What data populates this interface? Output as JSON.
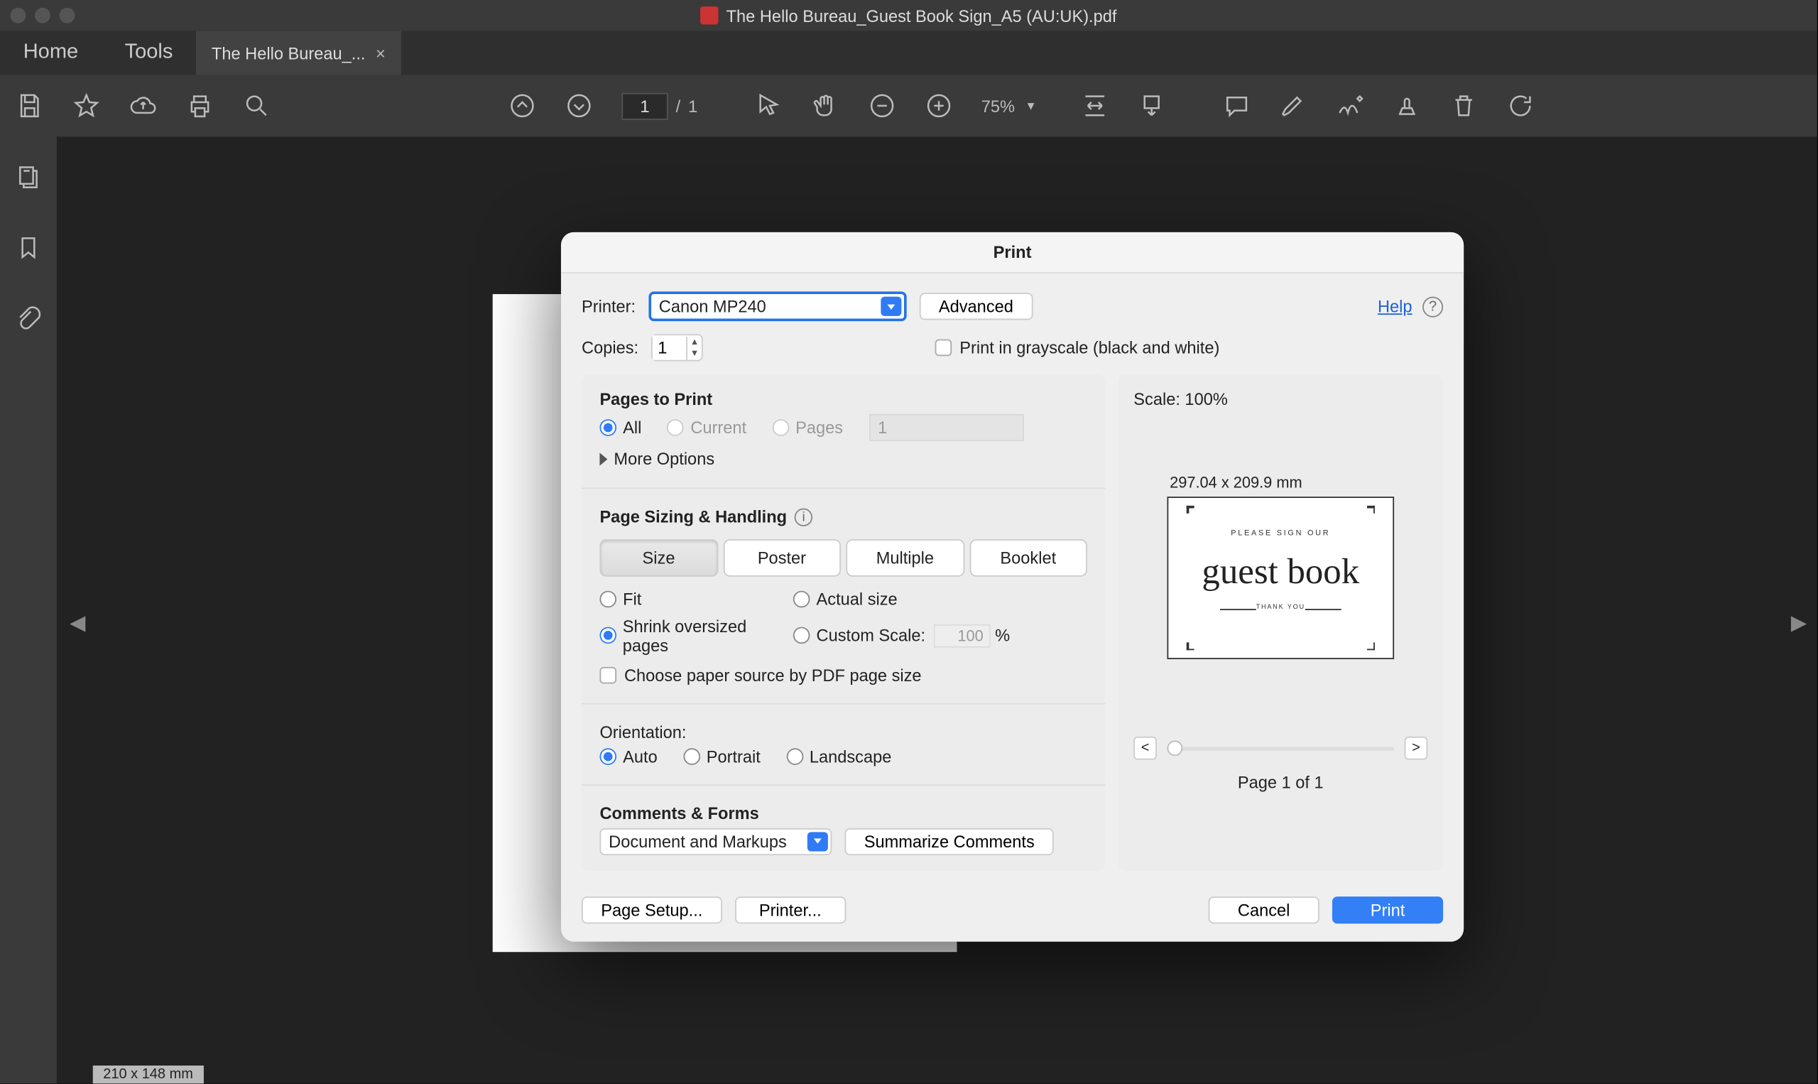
{
  "window": {
    "title": "The Hello Bureau_Guest Book Sign_A5 (AU:UK).pdf"
  },
  "tabs": {
    "home": "Home",
    "tools": "Tools",
    "document": "The Hello Bureau_..."
  },
  "toolbar": {
    "page_current": "1",
    "page_sep": "/",
    "page_total": "1",
    "zoom": "75%"
  },
  "doc": {
    "dim_label": "210 x 148 mm"
  },
  "print": {
    "title": "Print",
    "printer_label": "Printer:",
    "printer_value": "Canon MP240",
    "advanced": "Advanced",
    "help": "Help",
    "copies_label": "Copies:",
    "copies_value": "1",
    "grayscale": "Print in grayscale (black and white)",
    "pages_to_print": "Pages to Print",
    "radio_all": "All",
    "radio_current": "Current",
    "radio_pages": "Pages",
    "pages_field": "1",
    "more_options": "More Options",
    "sizing_head": "Page Sizing & Handling",
    "seg_size": "Size",
    "seg_poster": "Poster",
    "seg_multiple": "Multiple",
    "seg_booklet": "Booklet",
    "fit": "Fit",
    "actual": "Actual size",
    "shrink": "Shrink oversized pages",
    "custom_scale": "Custom Scale:",
    "custom_val": "100",
    "percent": "%",
    "choose_paper": "Choose paper source by PDF page size",
    "orientation": "Orientation:",
    "orient_auto": "Auto",
    "orient_portrait": "Portrait",
    "orient_landscape": "Landscape",
    "comments_head": "Comments & Forms",
    "comments_select": "Document and Markups",
    "summarize": "Summarize Comments",
    "scale_label": "Scale: 100%",
    "preview_dim": "297.04 x 209.9 mm",
    "preview_sign": "PLEASE SIGN OUR",
    "preview_main": "guest book",
    "preview_thank": "THANK YOU",
    "page_of": "Page 1 of 1",
    "prev": "<",
    "next": ">",
    "page_setup": "Page Setup...",
    "printer_btn": "Printer...",
    "cancel": "Cancel",
    "print_btn": "Print"
  }
}
